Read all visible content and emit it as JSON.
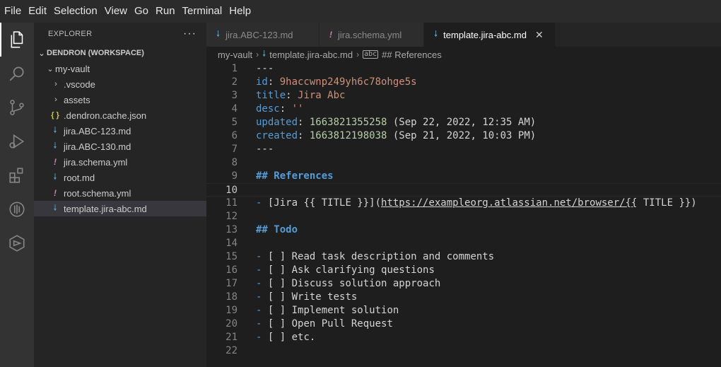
{
  "menu": [
    "File",
    "Edit",
    "Selection",
    "View",
    "Go",
    "Run",
    "Terminal",
    "Help"
  ],
  "activity": [
    "explorer-icon",
    "search-icon",
    "source-control-icon",
    "run-debug-icon",
    "extensions-icon",
    "docker-icon",
    "dendron-icon"
  ],
  "sidebar": {
    "title": "EXPLORER",
    "more": "···",
    "workspace": "DENDRON (WORKSPACE)",
    "vault": "my-vault",
    "items": [
      {
        "label": ".vscode"
      },
      {
        "label": "assets"
      },
      {
        "label": ".dendron.cache.json",
        "icon": "{ }"
      },
      {
        "label": "jira.ABC-123.md",
        "icon": "🠗"
      },
      {
        "label": "jira.ABC-130.md",
        "icon": "🠗"
      },
      {
        "label": "jira.schema.yml",
        "icon": "!"
      },
      {
        "label": "root.md",
        "icon": "🠗"
      },
      {
        "label": "root.schema.yml",
        "icon": "!"
      },
      {
        "label": "template.jira-abc.md",
        "icon": "🠗"
      }
    ]
  },
  "tabs": [
    {
      "label": "jira.ABC-123.md",
      "icon": "🠗"
    },
    {
      "label": "jira.schema.yml",
      "icon": "!"
    },
    {
      "label": "template.jira-abc.md",
      "icon": "🠗",
      "close": "✕"
    }
  ],
  "breadcrumb": {
    "vault": "my-vault",
    "sep": "›",
    "file": "template.jira-abc.md",
    "symbol": "##",
    "section": "References"
  },
  "editor": {
    "line_numbers": [
      "1",
      "2",
      "3",
      "4",
      "5",
      "6",
      "7",
      "8",
      "9",
      "10",
      "11",
      "12",
      "13",
      "14",
      "15",
      "16",
      "17",
      "18",
      "19",
      "20",
      "21",
      "22"
    ],
    "l1": "---",
    "l2_key": "id",
    "l2_val": "9haccwnp249yh6c78ohge5s",
    "l3_key": "title",
    "l3_val": "Jira Abc",
    "l4_key": "desc",
    "l4_val": "''",
    "l5_key": "updated",
    "l5_num": "1663821355258",
    "l5_comment": " (Sep 22, 2022, 12:35 AM)",
    "l6_key": "created",
    "l6_num": "1663812198038",
    "l6_comment": " (Sep 21, 2022, 10:03 PM)",
    "l7": "---",
    "l9_head": "## References",
    "l11_bullet": "-",
    "l11_text": " [Jira {{ TITLE }}](",
    "l11_link": "https://exampleorg.atlassian.net/browser/{{",
    "l11_tail": " TITLE }})",
    "l13_head": "## Todo",
    "todos": [
      " [ ] Read task description and comments",
      " [ ] Ask clarifying questions",
      " [ ] Discuss solution approach",
      " [ ] Write tests",
      " [ ] Implement solution",
      " [ ] Open Pull Request",
      " [ ] etc."
    ]
  }
}
